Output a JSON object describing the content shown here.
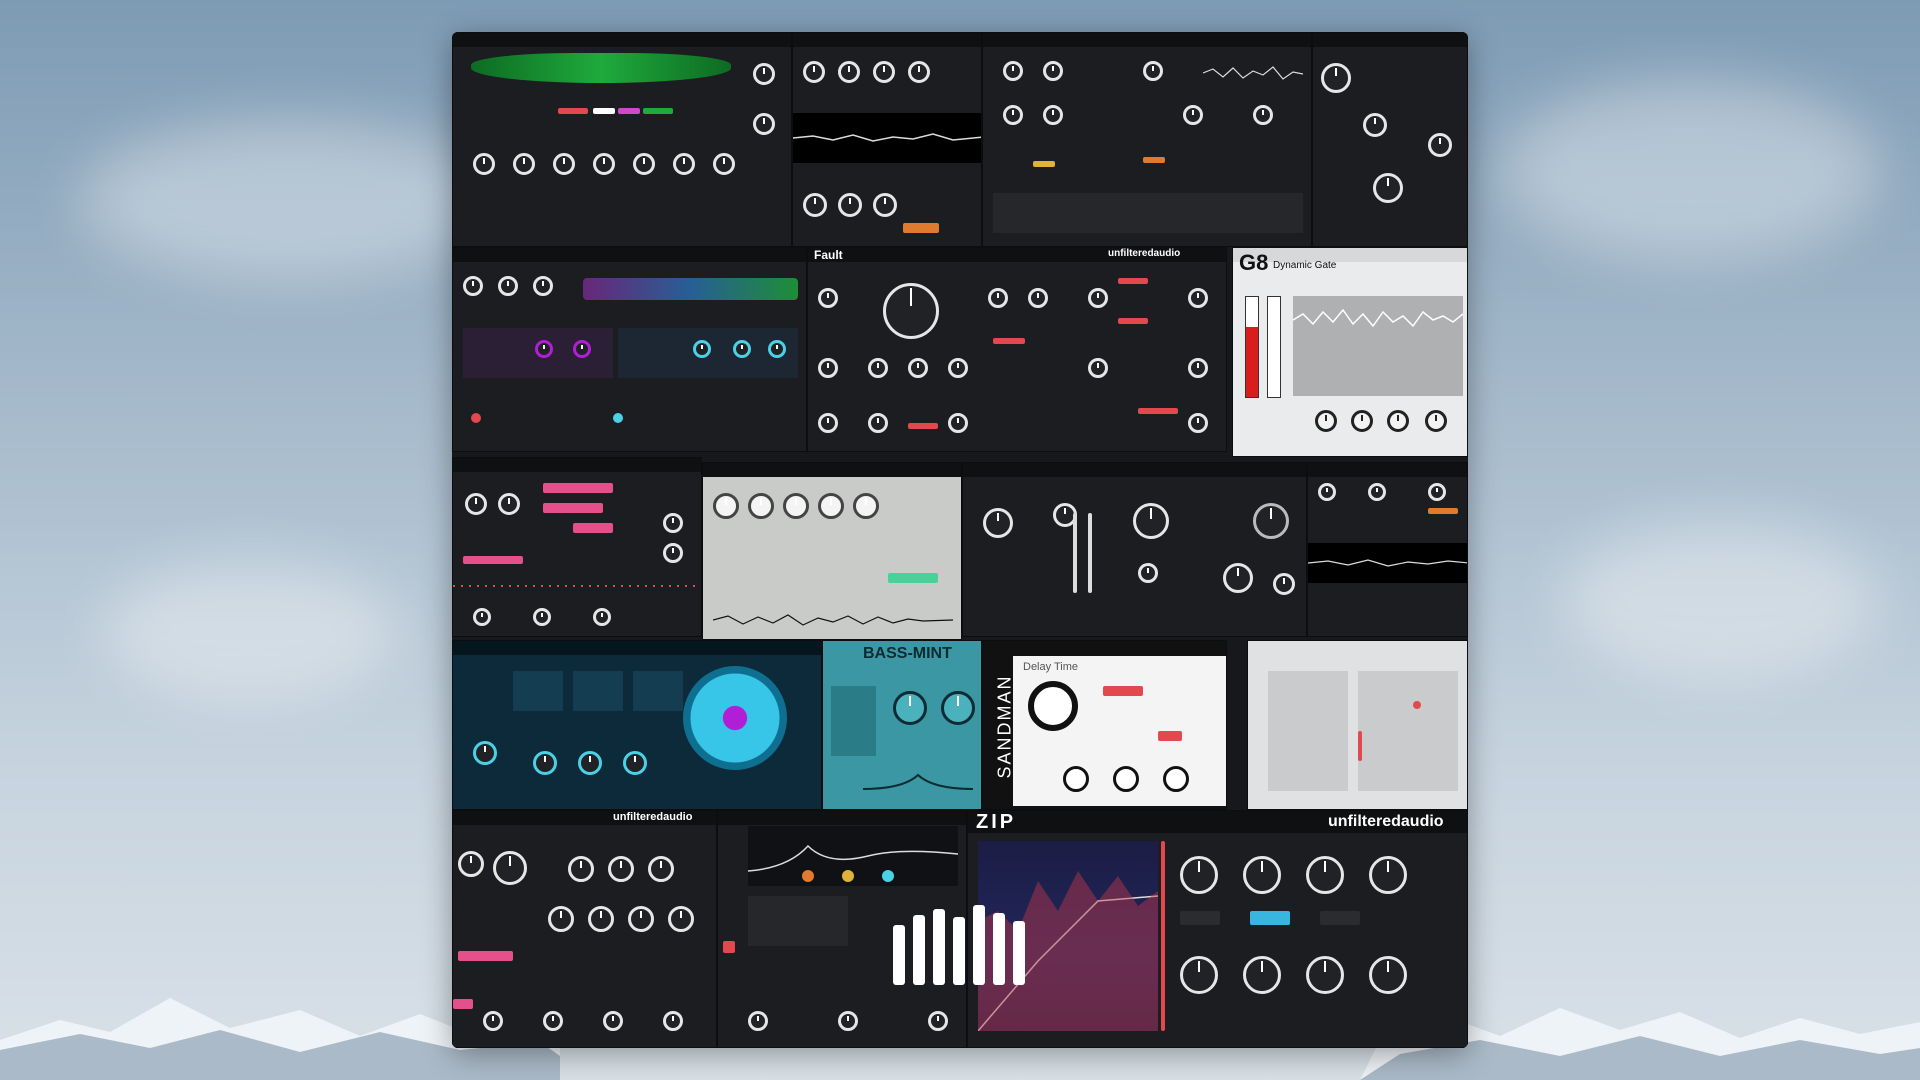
{
  "colors": {
    "sky_top": "#7e9bb4",
    "sky_bottom": "#d9e1e8",
    "collage_bg": "#16181b",
    "accent_green": "#1faa3c",
    "accent_red": "#e2484d",
    "accent_teal": "#3a97a3",
    "accent_magenta": "#b01fd6",
    "accent_cyan": "#4ad1e6"
  },
  "plugins": {
    "fault": "Fault",
    "g8": "G8",
    "g8_sub": "Dynamic Gate",
    "bass_mint": "BASS-MINT",
    "sandman": "SANDMAN",
    "zip": "ZIP",
    "unfiltered_audio": "unfilteredaudio",
    "delay_time": "Delay Time"
  },
  "icons": {
    "logo": "plugin-alliance-bars-icon"
  }
}
